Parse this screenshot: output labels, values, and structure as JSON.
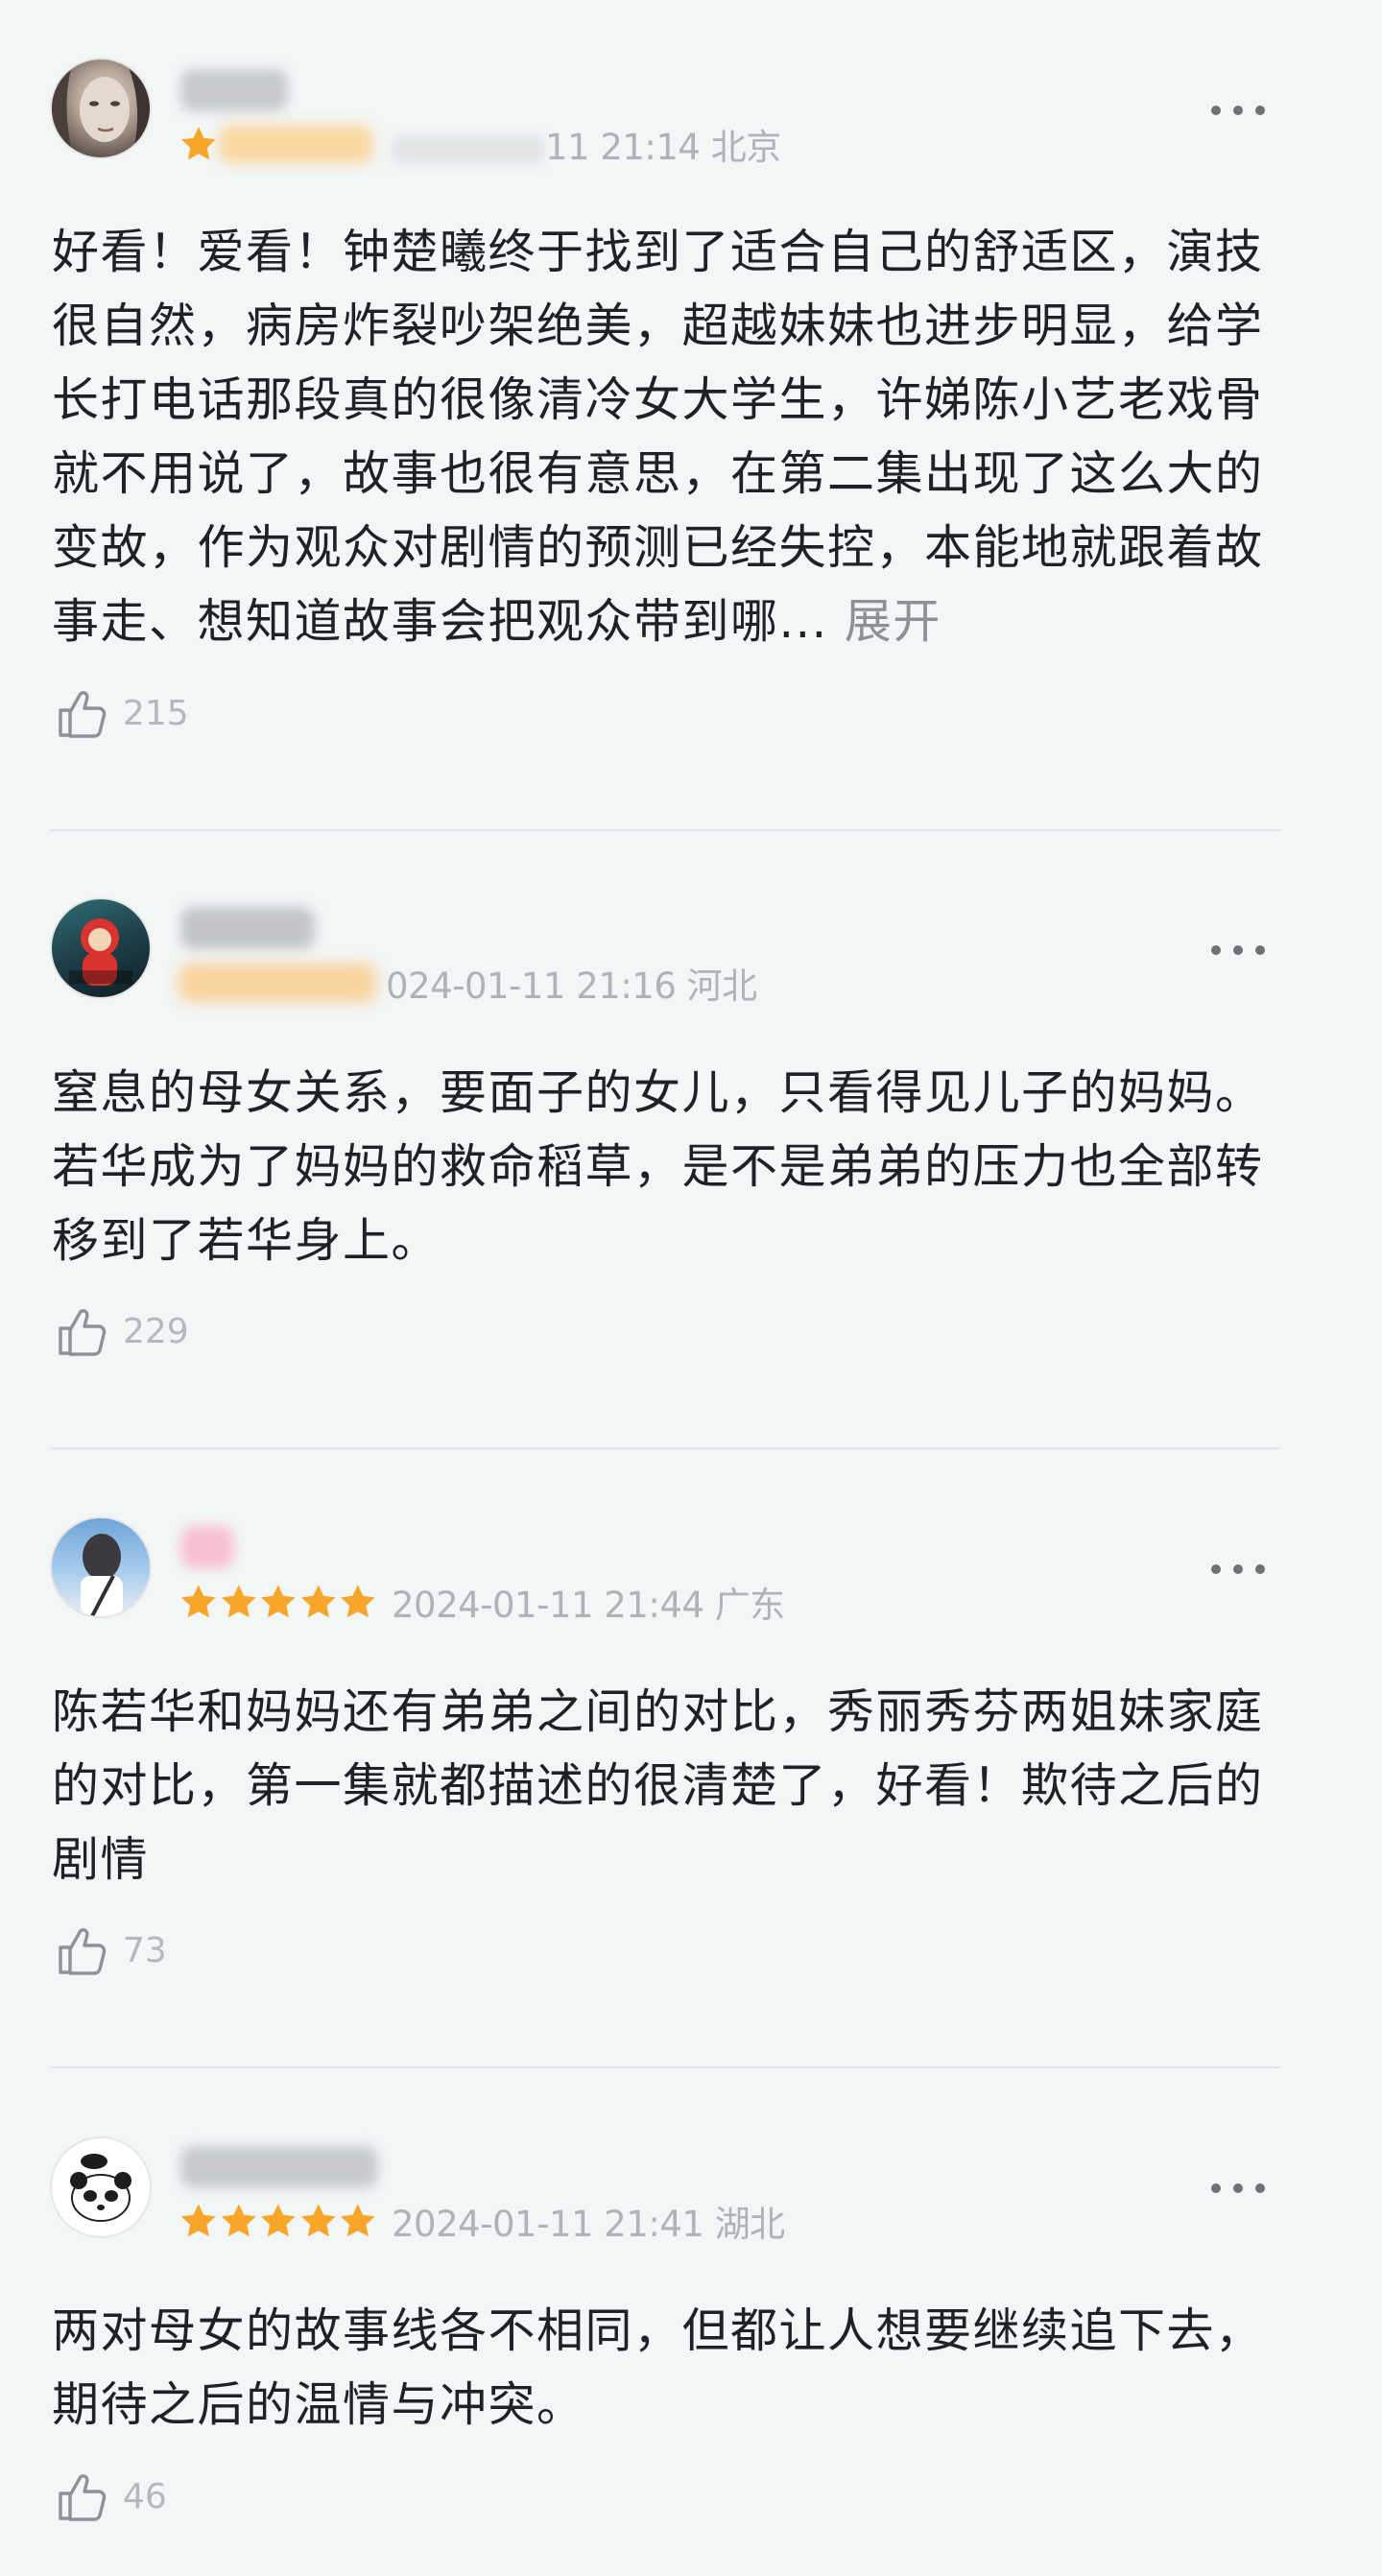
{
  "comments": [
    {
      "username": "",
      "date_visible": "11 21:14",
      "location": "北京",
      "rating": 1,
      "text": "好看！爱看！钟楚曦终于找到了适合自己的舒适区，演技很自然，病房炸裂吵架绝美，超越妹妹也进步明显，给学长打电话那段真的很像清冷女大学生，许娣陈小艺老戏骨就不用说了，故事也很有意思，在第二集出现了这么大的变故，作为观众对剧情的预测已经失控，本能地就跟着故事走、想知道故事会把观众带到哪...",
      "expand_label": "展开",
      "likes": "215"
    },
    {
      "username": "",
      "date_visible": "024-01-11 21:16",
      "location": "河北",
      "rating": 0,
      "text": "窒息的母女关系，要面子的女儿，只看得见儿子的妈妈。若华成为了妈妈的救命稻草，是不是弟弟的压力也全部转移到了若华身上。",
      "likes": "229"
    },
    {
      "username": "",
      "date_visible": "2024-01-11 21:44",
      "location": "广东",
      "rating": 5,
      "text": "陈若华和妈妈还有弟弟之间的对比，秀丽秀芬两姐妹家庭的对比，第一集就都描述的很清楚了，好看！欺待之后的剧情",
      "likes": "73"
    },
    {
      "username": "",
      "date_visible": "2024-01-11 21:41",
      "location": "湖北",
      "rating": 5,
      "text": "两对母女的故事线各不相同，但都让人想要继续追下去，期待之后的温情与冲突。",
      "likes": "46"
    }
  ],
  "icons": {
    "more": "more-dots-icon",
    "like": "thumbs-up-icon",
    "star": "star-icon"
  },
  "colors": {
    "star": "#f7a62a",
    "text": "#1f2124",
    "meta": "#b0b3b6",
    "expand": "#8d9196",
    "background": "#f3f6f7"
  }
}
